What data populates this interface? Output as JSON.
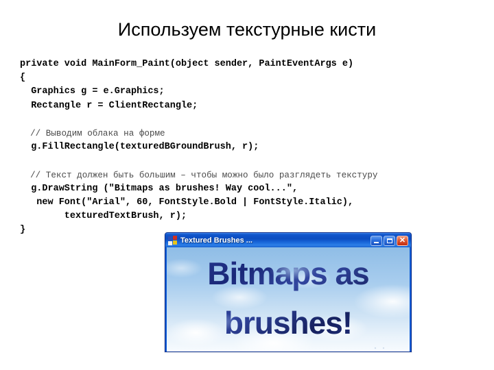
{
  "slide": {
    "title": "Используем текстурные кисти"
  },
  "code": {
    "lines": [
      {
        "text": "private void MainForm_Paint(object sender, PaintEventArgs e)",
        "style": "kw"
      },
      {
        "text": "{",
        "style": "kw"
      },
      {
        "text": "  Graphics g = e.Graphics;",
        "style": "kw"
      },
      {
        "text": "  Rectangle r = ClientRectangle;",
        "style": "kw"
      },
      {
        "text": " ",
        "style": "blank"
      },
      {
        "text": "  // Выводим облака на форме",
        "style": "comment"
      },
      {
        "text": "  g.FillRectangle(texturedBGroundBrush, r);",
        "style": "kw"
      },
      {
        "text": " ",
        "style": "blank"
      },
      {
        "text": "  // Текст должен быть большим – чтобы можно было разглядеть текстуру",
        "style": "comment"
      },
      {
        "text": "  g.DrawString (\"Bitmaps as brushes! Way cool...\",",
        "style": "kw"
      },
      {
        "text": "   new Font(\"Arial\", 60, FontStyle.Bold | FontStyle.Italic),",
        "style": "kw"
      },
      {
        "text": "        texturedTextBrush, r);",
        "style": "kw"
      },
      {
        "text": "}",
        "style": "kw"
      }
    ]
  },
  "app_window": {
    "title": "Textured Brushes ...",
    "icon": "windows-forms-app-icon",
    "controls": {
      "minimize_label": "_",
      "maximize_label": "□",
      "close_label": "✕"
    },
    "client": {
      "text": "Bitmaps as\nbrushes!",
      "text_color": "#1b2a80",
      "background": "sky-clouds-texture"
    }
  },
  "colors": {
    "page_background": "#ffffff",
    "title_text": "#000000",
    "code_text": "#000000",
    "comment_text": "#4a4a4a",
    "titlebar_blue": "#0f53c8",
    "titlebar_text": "#ffffff",
    "close_button_red": "#d9400f",
    "window_border": "#0b2f8f",
    "sky_light": "#f7fbfe",
    "sky_dark": "#8fbde6"
  }
}
